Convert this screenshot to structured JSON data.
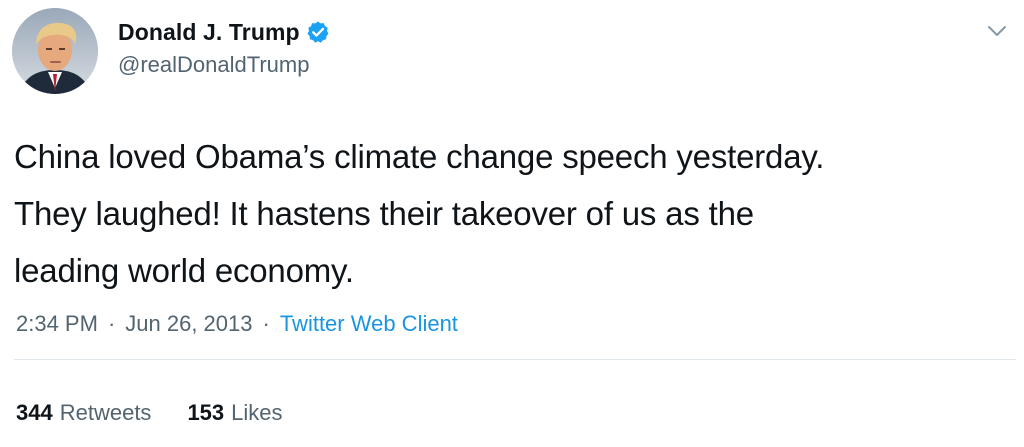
{
  "author": {
    "display_name": "Donald J. Trump",
    "handle": "@realDonaldTrump",
    "verified": true,
    "avatar_icon": "profile-photo"
  },
  "tweet": {
    "text": "China loved Obama’s climate change speech yesterday.\nThey laughed! It hastens their takeover of us as the\nleading world economy."
  },
  "meta": {
    "time": "2:34 PM",
    "separator": "·",
    "date": "Jun 26, 2013",
    "client": "Twitter Web Client"
  },
  "stats": {
    "retweets_count": "344",
    "retweets_label": "Retweets",
    "likes_count": "153",
    "likes_label": "Likes"
  },
  "colors": {
    "link": "#1b95e0",
    "verified": "#1da1f2",
    "secondary_text": "#536471",
    "divider": "#e1e8ed"
  }
}
